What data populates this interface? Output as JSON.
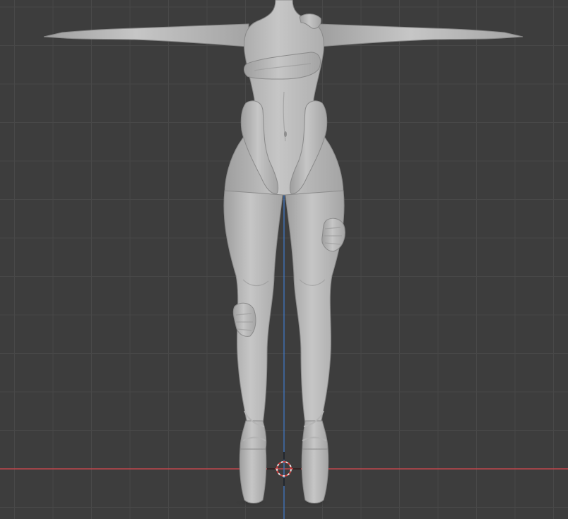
{
  "viewport": {
    "background_color": "#3d3d3d",
    "grid_color": "#484848",
    "x_axis_color": "#c0464c",
    "z_axis_color": "#3f73b8",
    "model_color": "#bcbcbc"
  },
  "objects": {
    "model": "sculpted-figure",
    "cursor": "3d-cursor-icon"
  }
}
